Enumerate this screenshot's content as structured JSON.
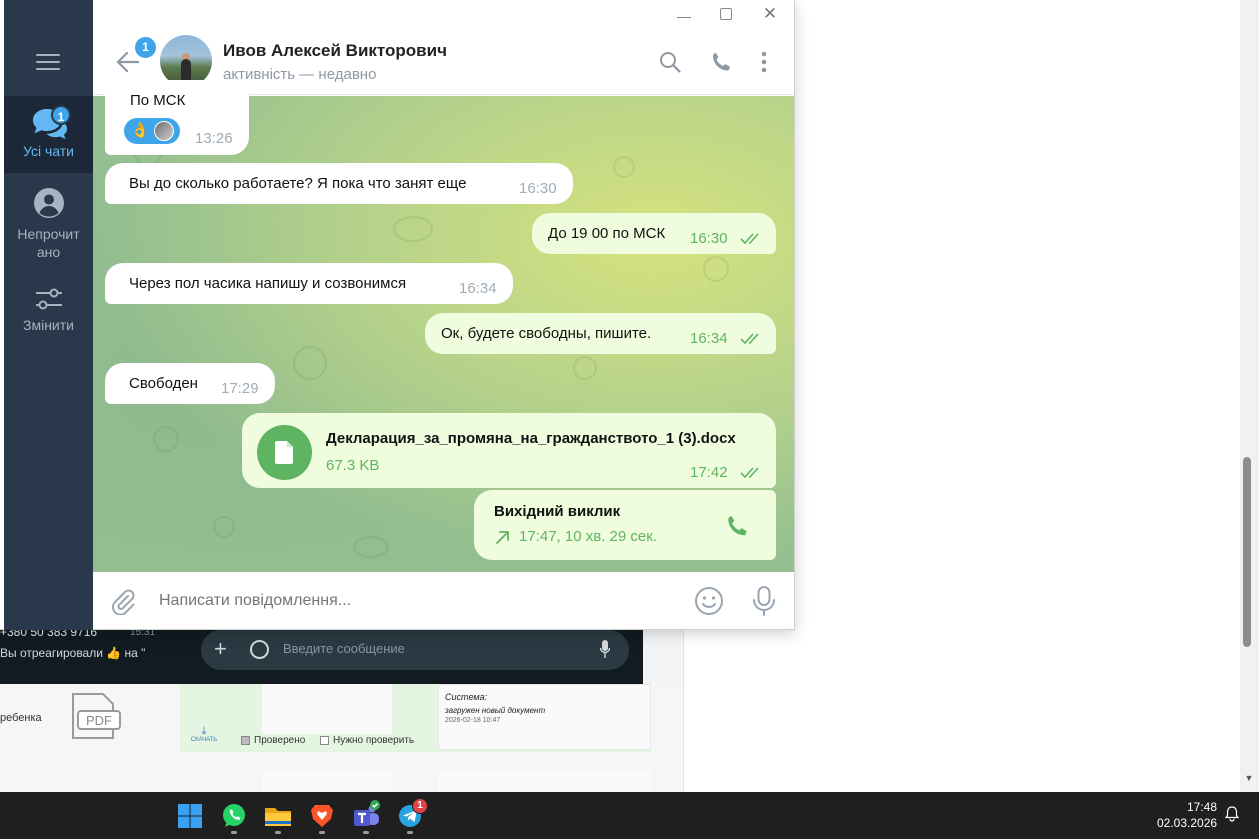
{
  "window": {
    "controls": {
      "minimize": "minimize",
      "maximize": "maximize",
      "close": "✕"
    }
  },
  "sidebar": {
    "folders": [
      {
        "label": "Усі чати",
        "badge": "1",
        "active": true
      },
      {
        "label": "Непрочит\nано",
        "line1": "Непрочит",
        "line2": "ано"
      },
      {
        "label": "Змінити"
      }
    ]
  },
  "header": {
    "back_badge": "1",
    "contact_name": "Ивов Алексей Викторович",
    "status": "активність — недавно"
  },
  "messages": [
    {
      "dir": "in",
      "text": "По МСК",
      "time": "13:26",
      "reactions": [
        "👌",
        "avatar"
      ]
    },
    {
      "dir": "in",
      "text": "Вы до сколько работаете? Я пока что  занят еще",
      "time": "16:30"
    },
    {
      "dir": "out",
      "text": "До 19 00 по МСК",
      "time": "16:30",
      "read": true
    },
    {
      "dir": "in",
      "text": "Через пол часика напишу и созвонимся",
      "time": "16:34"
    },
    {
      "dir": "out",
      "text": "Ок, будете свободны, пишите.",
      "time": "16:34",
      "read": true
    },
    {
      "dir": "in",
      "text": "Свободен",
      "time": "17:29"
    },
    {
      "dir": "out",
      "type": "file",
      "file_name": "Декларация_за_промяна_на_гражданството_1 (3).docx",
      "file_size": "67.3 KB",
      "time": "17:42",
      "read": true
    },
    {
      "dir": "out",
      "type": "call",
      "title": "Вихідний виклик",
      "info": "17:47, 10 хв. 29 сек."
    }
  ],
  "composer": {
    "placeholder": "Написати повідомлення..."
  },
  "background": {
    "whatsapp": {
      "contact": "+380 50 383 9716",
      "time": "15:31",
      "last_message": "Вы отреагировали 👍 на \"",
      "input_placeholder": "Введите сообщение"
    },
    "crm": {
      "child_label": "ребенка",
      "pdf_label": "PDF",
      "download_label": "СКАЧАТЬ",
      "checked_label": "Проверено",
      "unchecked_label": "Нужно проверить",
      "system_title": "Система:",
      "system_message": "загружен новый документ",
      "system_date": "2026-02-18 10:47"
    }
  },
  "taskbar": {
    "apps": [
      "windows-start",
      "whatsapp",
      "file-explorer",
      "brave",
      "teams",
      "telegram"
    ],
    "telegram_badge": "1",
    "time": "17:48",
    "date": "02.03.2026"
  },
  "colors": {
    "sidebar_bg": "#29384a",
    "accent_blue": "#3fa5ea",
    "outgoing_bubble": "#effdde",
    "outgoing_meta": "#5fb461"
  }
}
